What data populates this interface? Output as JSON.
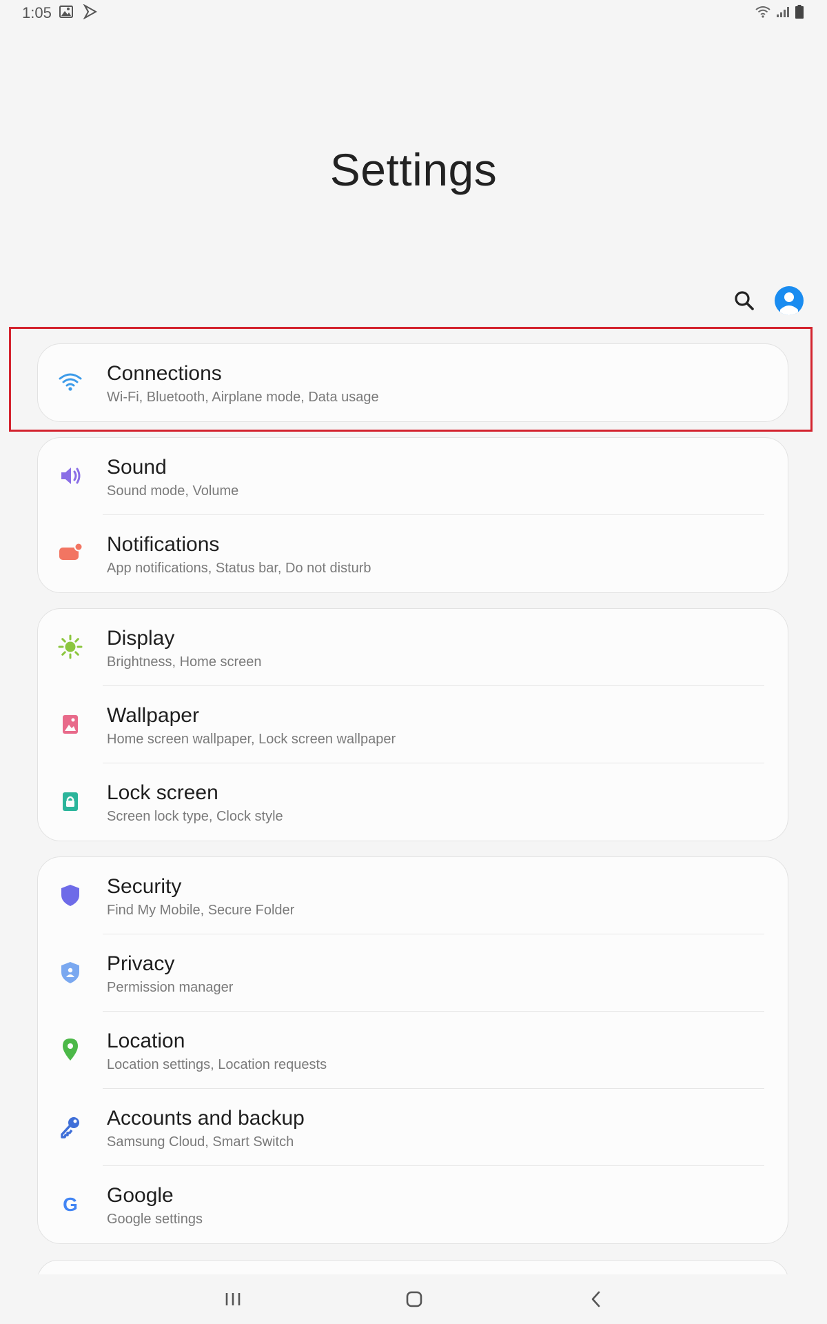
{
  "status_bar": {
    "time": "1:05",
    "left_icons": [
      "gallery-icon",
      "sprint-icon"
    ],
    "right_icons": [
      "wifi-icon",
      "signal-icon",
      "battery-icon"
    ]
  },
  "header": {
    "title": "Settings",
    "search_icon": "search-icon",
    "profile_icon": "account-icon",
    "profile_color": "#1a8cf0"
  },
  "highlight_color": "#d3232e",
  "groups": [
    {
      "items": [
        {
          "title": "Connections",
          "subtitle": "Wi-Fi, Bluetooth, Airplane mode, Data usage",
          "icon": "wifi-icon",
          "color": "#3d9be9"
        }
      ]
    },
    {
      "items": [
        {
          "title": "Sound",
          "subtitle": "Sound mode, Volume",
          "icon": "volume-icon",
          "color": "#8a6ee6"
        },
        {
          "title": "Notifications",
          "subtitle": "App notifications, Status bar, Do not disturb",
          "icon": "notification-icon",
          "color": "#f27562"
        }
      ]
    },
    {
      "items": [
        {
          "title": "Display",
          "subtitle": "Brightness, Home screen",
          "icon": "brightness-icon",
          "color": "#8cc63f"
        },
        {
          "title": "Wallpaper",
          "subtitle": "Home screen wallpaper, Lock screen wallpaper",
          "icon": "wallpaper-icon",
          "color": "#e86a8a"
        },
        {
          "title": "Lock screen",
          "subtitle": "Screen lock type, Clock style",
          "icon": "lock-icon",
          "color": "#2bb59b"
        }
      ]
    },
    {
      "items": [
        {
          "title": "Security",
          "subtitle": "Find My Mobile, Secure Folder",
          "icon": "shield-icon",
          "color": "#6e6be8"
        },
        {
          "title": "Privacy",
          "subtitle": "Permission manager",
          "icon": "privacy-shield-icon",
          "color": "#7aa8f0"
        },
        {
          "title": "Location",
          "subtitle": "Location settings, Location requests",
          "icon": "location-pin-icon",
          "color": "#4cb848"
        },
        {
          "title": "Accounts and backup",
          "subtitle": "Samsung Cloud, Smart Switch",
          "icon": "key-icon",
          "color": "#3f6fd8"
        },
        {
          "title": "Google",
          "subtitle": "Google settings",
          "icon": "google-icon",
          "color": "#4285f4"
        }
      ]
    }
  ],
  "navbar": {
    "buttons": [
      "recents-icon",
      "home-icon",
      "back-icon"
    ]
  }
}
